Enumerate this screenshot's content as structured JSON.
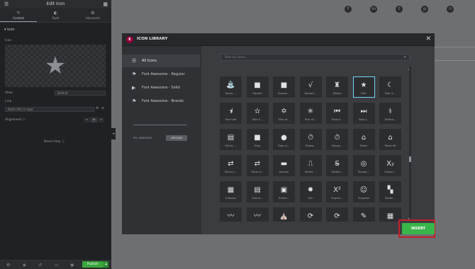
{
  "editor": {
    "title": "Edit Icon",
    "tabs": [
      {
        "label": "Content",
        "icon": "pencil-icon",
        "glyph": "✎"
      },
      {
        "label": "Style",
        "icon": "circle-half-icon",
        "glyph": "◐"
      },
      {
        "label": "Advanced",
        "icon": "gear-icon",
        "glyph": "⚙"
      }
    ],
    "section": "Icon",
    "icon_label": "Icon",
    "view_label": "View",
    "view_value": "Default",
    "link_label": "Link",
    "link_placeholder": "Paste URL or type",
    "alignment_label": "Alignment",
    "need_help": "Need Help",
    "publish": "Publish"
  },
  "modal": {
    "title": "ICON LIBRARY",
    "search_placeholder": "Filter by name...",
    "sidebar": [
      {
        "label": "All Icons",
        "icon": "lines-icon",
        "glyph": "☰"
      },
      {
        "label": "Font Awesome - Regular",
        "icon": "flag-outline-icon",
        "glyph": "⚑"
      },
      {
        "label": "Font Awesome - Solid",
        "icon": "flag-icon",
        "glyph": "▶"
      },
      {
        "label": "Font Awesome - Brands",
        "icon": "flag-brands-icon",
        "glyph": "⚑"
      }
    ],
    "my_libraries": "MY LIBRARIES",
    "upload": "UPLOAD",
    "insert": "INSERT",
    "selected": "Star",
    "icons": [
      [
        "Spray ...",
        "Square",
        "Square...",
        "Square...",
        "Stamp",
        "Star",
        "Star a..."
      ],
      [
        "Star half",
        "Star h...",
        "Star of...",
        "Star of...",
        "Step b...",
        "Step f...",
        "Stetho..."
      ],
      [
        "Sticky ...",
        "Stop",
        "Stop ci...",
        "Stopw...",
        "Stopw...",
        "Store",
        "Store alt"
      ],
      [
        "Store a...",
        "Store a...",
        "Stream",
        "Street ...",
        "Striket...",
        "Stroop...",
        "Subscr..."
      ],
      [
        "Subway",
        "Suitca...",
        "Suitca...",
        "Sun",
        "Supers...",
        "Surprise",
        "Swatc..."
      ],
      [
        "Swim...",
        "Swim...",
        "Synag...",
        "Sync",
        "Sync alt",
        "Syringe",
        "Table"
      ]
    ],
    "glyphs": [
      [
        "⛲",
        "■",
        "■",
        "√",
        "♜",
        "★",
        "☾"
      ],
      [
        "⯨",
        "✫",
        "✡",
        "✳",
        "⏮",
        "⏭",
        "⚕"
      ],
      [
        "▤",
        "■",
        "●",
        "⏱",
        "⏱",
        "⌂",
        "⌂"
      ],
      [
        "⇄",
        "⇄",
        "▬",
        "⎍",
        "S̶",
        "◎",
        "X₂"
      ],
      [
        "▦",
        "▤",
        "▣",
        "✹",
        "X²",
        "☺",
        "▚"
      ],
      [
        "〰",
        "〰",
        "⛪",
        "⟳",
        "⟳",
        "✎",
        "▦"
      ]
    ]
  },
  "page": {
    "social": [
      {
        "icon": "facebook-icon",
        "glyph": "f"
      },
      {
        "icon": "linkedin-icon",
        "glyph": "in"
      },
      {
        "icon": "twitter-icon",
        "glyph": "t"
      },
      {
        "icon": "pinterest-icon",
        "glyph": "p"
      },
      {
        "icon": "email-icon",
        "glyph": "✉"
      }
    ]
  }
}
